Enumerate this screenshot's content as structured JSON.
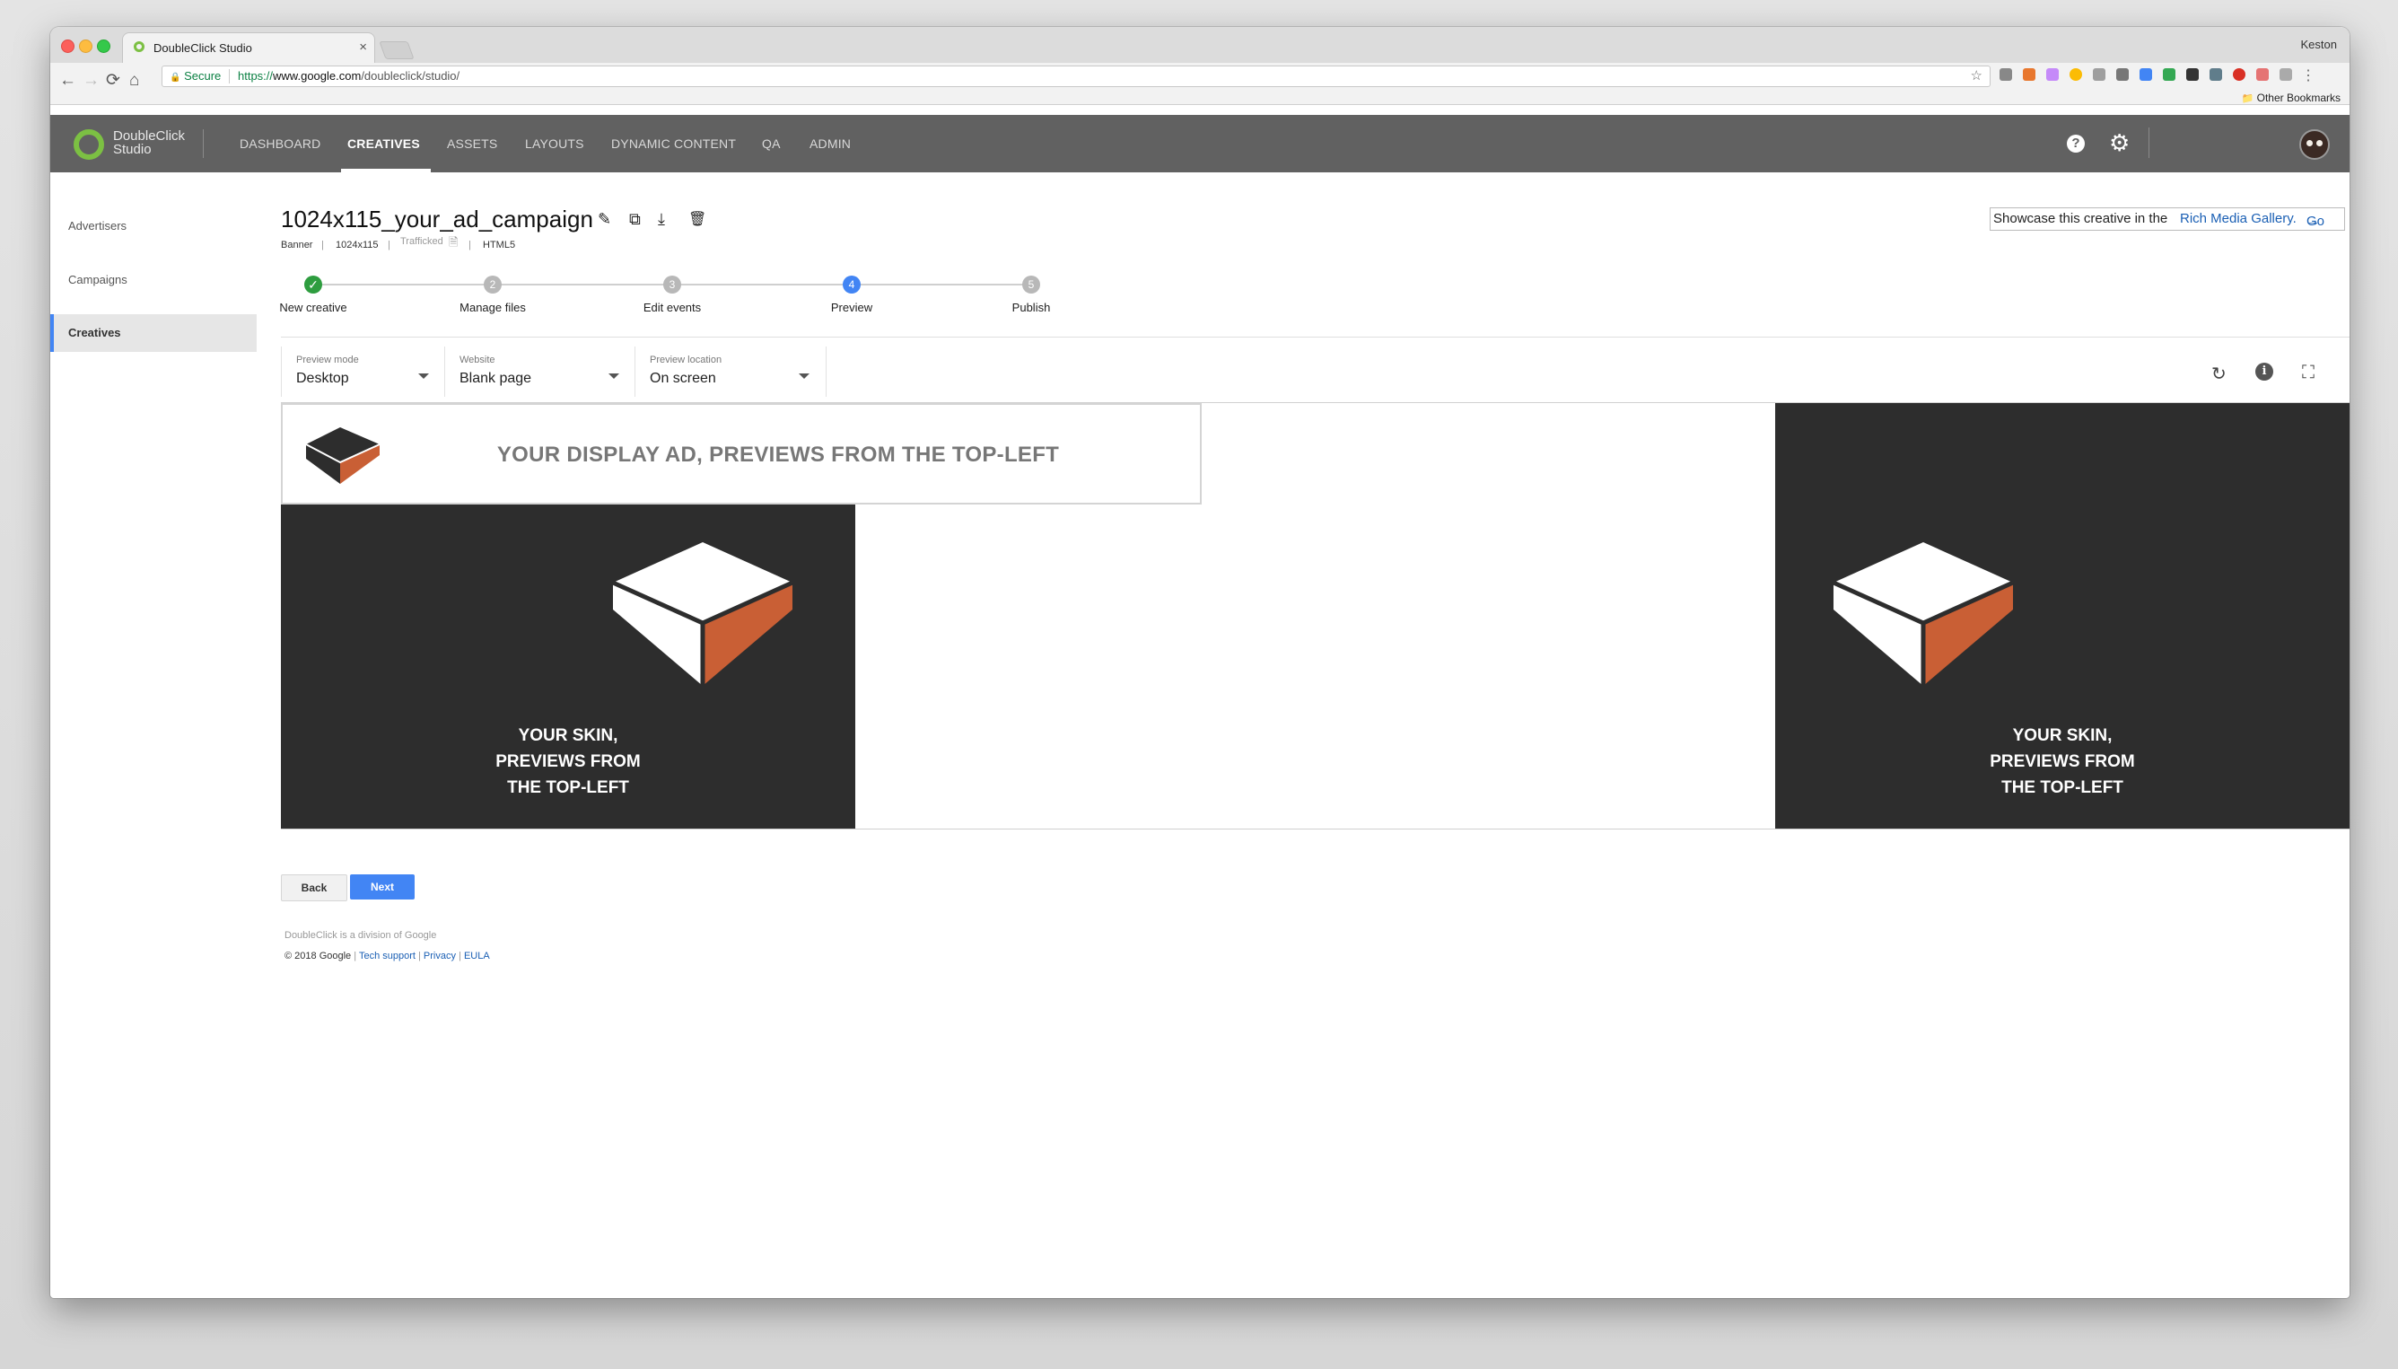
{
  "browser": {
    "tab_title": "DoubleClick Studio",
    "tab_close": "×",
    "user_name": "Keston",
    "secure_label": "Secure",
    "url_scheme": "https://",
    "url_host": "www.google.com",
    "url_path": "/doubleclick/studio/",
    "other_bookmarks": "Other Bookmarks",
    "star_icon": "star-icon",
    "nav_back_icon": "←",
    "nav_forward_icon": "→",
    "reload_glyph": "⟳",
    "home_glyph": "⌂",
    "star_glyph": "☆",
    "lock_glyph": "🔒",
    "folder_glyph": "📁"
  },
  "appbar": {
    "logo_line1": "DoubleClick",
    "logo_line2": "Studio",
    "nav": [
      "DASHBOARD",
      "CREATIVES",
      "ASSETS",
      "LAYOUTS",
      "DYNAMIC CONTENT",
      "QA",
      "ADMIN"
    ],
    "active_nav": "CREATIVES",
    "help_glyph": "?",
    "gear_glyph": "⚙",
    "accent_color": "#7cc043"
  },
  "sidebar": {
    "items": [
      "Advertisers",
      "Campaigns",
      "Creatives"
    ],
    "active": "Creatives",
    "active_color": "#4285f4"
  },
  "creative": {
    "title": "1024x115_your_ad_campaign",
    "meta": {
      "type": "Banner",
      "size": "1024x115",
      "status": "Trafficked",
      "format": "HTML5",
      "separator": "|"
    },
    "icon_glyphs": {
      "edit": "✎",
      "duplicate": "⧉",
      "download": "⤓",
      "delete": "🗑",
      "doc": "🗎"
    },
    "showcase_text": "Showcase this creative in the",
    "showcase_link": "Rich Media Gallery.",
    "showcase_go": "Go",
    "showcase_arrow": "→"
  },
  "stepper": {
    "steps": [
      {
        "num": "✓",
        "label": "New creative",
        "state": "done"
      },
      {
        "num": "2",
        "label": "Manage files",
        "state": "pending"
      },
      {
        "num": "3",
        "label": "Edit events",
        "state": "pending"
      },
      {
        "num": "4",
        "label": "Preview",
        "state": "current"
      },
      {
        "num": "5",
        "label": "Publish",
        "state": "pending"
      }
    ]
  },
  "preview_controls": {
    "preview_mode_label": "Preview mode",
    "preview_mode_value": "Desktop",
    "website_label": "Website",
    "website_value": "Blank page",
    "location_label": "Preview location",
    "location_value": "On screen",
    "refresh_glyph": "↻",
    "info_glyph": "i",
    "fullscreen_glyph": "⛶"
  },
  "preview": {
    "banner_text": "YOUR DISPLAY AD, PREVIEWS FROM THE TOP-LEFT",
    "skin_text_lines": [
      "YOUR SKIN,",
      "PREVIEWS FROM",
      "THE TOP-LEFT"
    ],
    "skin_color": "#2d2d2d",
    "cube_accent": "#c95f35"
  },
  "actions": {
    "back": "Back",
    "next": "Next"
  },
  "footer": {
    "division": "DoubleClick is a division of Google",
    "copyright": "© 2018 Google",
    "tech_support": "Tech support",
    "privacy": "Privacy",
    "eula": "EULA",
    "separator": "|"
  }
}
